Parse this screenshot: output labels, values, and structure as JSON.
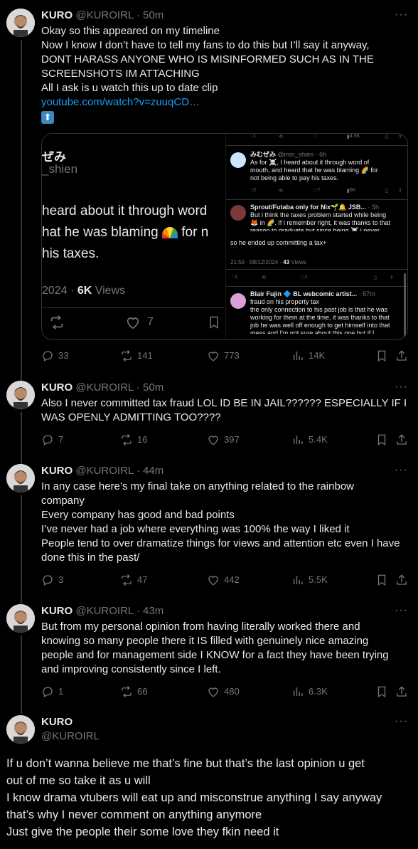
{
  "tweets": [
    {
      "name": "KURO",
      "handle": "@KUROIRL",
      "time": "· 50m",
      "lines": [
        "Okay so this appeared on my timeline",
        "Now I know I don’t have to tell my fans to do this but I’ll say it anyway,",
        "DONT HARASS ANYONE WHO IS MISINFORMED SUCH AS IN THE",
        "SCREENSHOTS IM ATTACHING",
        "All I ask is u watch this up to date clip"
      ],
      "link": "youtube.com/watch?v=zuuqCD…",
      "stats": {
        "replies": "33",
        "reposts": "141",
        "likes": "773",
        "views": "14K"
      }
    },
    {
      "name": "KURO",
      "handle": "@KUROIRL",
      "time": "· 50m",
      "lines": [
        "Also I never committed tax fraud LOL ID BE IN JAIL?????? ESPECIALLY IF I",
        "WAS OPENLY ADMITTING TOO????"
      ],
      "stats": {
        "replies": "7",
        "reposts": "16",
        "likes": "397",
        "views": "5.4K"
      }
    },
    {
      "name": "KURO",
      "handle": "@KUROIRL",
      "time": "· 44m",
      "lines": [
        "In any case here’s my final take on anything related to the rainbow",
        "company",
        "Every company has good and bad points",
        "I’ve never had a job where everything was 100% the way I liked it",
        "People tend to over dramatize things for views and attention etc even I have",
        "done this in the past/"
      ],
      "stats": {
        "replies": "3",
        "reposts": "47",
        "likes": "442",
        "views": "5.5K"
      }
    },
    {
      "name": "KURO",
      "handle": "@KUROIRL",
      "time": "· 43m",
      "lines": [
        "But from my personal opinion from having literally worked there and",
        "knowing so many people there it IS filled with genuinely nice amazing",
        "people and for management side I KNOW for a fact they have been trying",
        "and improving consistently since I left."
      ],
      "stats": {
        "replies": "1",
        "reposts": "66",
        "likes": "480",
        "views": "6.3K"
      }
    }
  ],
  "main": {
    "name": "KURO",
    "handle": "@KUROIRL",
    "lines": [
      "If u don’t wanna believe me that’s fine but that’s the last opinion u get",
      "out of me so take it as u will",
      "I know drama vtubers will eat up and misconstrue anything I say anyway",
      "that’s why I never comment on anything anymore",
      "Just give the people their some love they fkin need it"
    ]
  },
  "media": {
    "left": {
      "name_frag": "ぜみ",
      "handle_frag": "_shien",
      "line1": "heard about it through word",
      "line2a": "hat he was blaming",
      "line2b": "for n",
      "line3": "his taxes.",
      "date_frag": "2024 ·",
      "views_num": "6K",
      "views_label": "Views",
      "likes": "7"
    },
    "right": {
      "top_stats": {
        "replies": "1",
        "reposts": "",
        "likes": "",
        "views": "4.5K"
      },
      "r1_name": "みむぜみ",
      "r1_handle": "@mm_shien · 6h",
      "r1_text": [
        "As for ☠️, I heard about it through word of",
        "mouth, and heard that he was blaming 🌈 for",
        "not being able to pay his taxes."
      ],
      "r1_stats": {
        "replies": "2",
        "likes": "7",
        "views": "6K"
      },
      "r2_name": "Sprout/Futaba only for Nix🌱🔔 JSB...",
      "r2_time": "· 5h",
      "r2_text": [
        "But i think the taxes problem started while being",
        "🦊 in 🌈. If i remember right, it was thanks to that",
        "reason to graduate but since being ☠️ i never"
      ],
      "quote": "so he ended up committing a tax+",
      "stamp": "21:59 · 08/12/2024 ·",
      "stamp_views": "43",
      "stamp_views_label": "Views",
      "stamp_stats": {
        "replies": "1",
        "likes": "1"
      },
      "r3_name": "Blair Fujin 🔷 BL webcomic artist...",
      "r3_time": "· 57m",
      "r3_text": [
        "fraud on his property tax",
        "the only connection to his past job is that he was",
        "working for them at the time, it was thanks to that",
        "job he was well off enough to get himself into that",
        "mess and I'm not sure about this one but if I"
      ]
    }
  },
  "colors": {
    "link": "#1d9bf0",
    "muted": "#71767b",
    "line": "#333639"
  }
}
